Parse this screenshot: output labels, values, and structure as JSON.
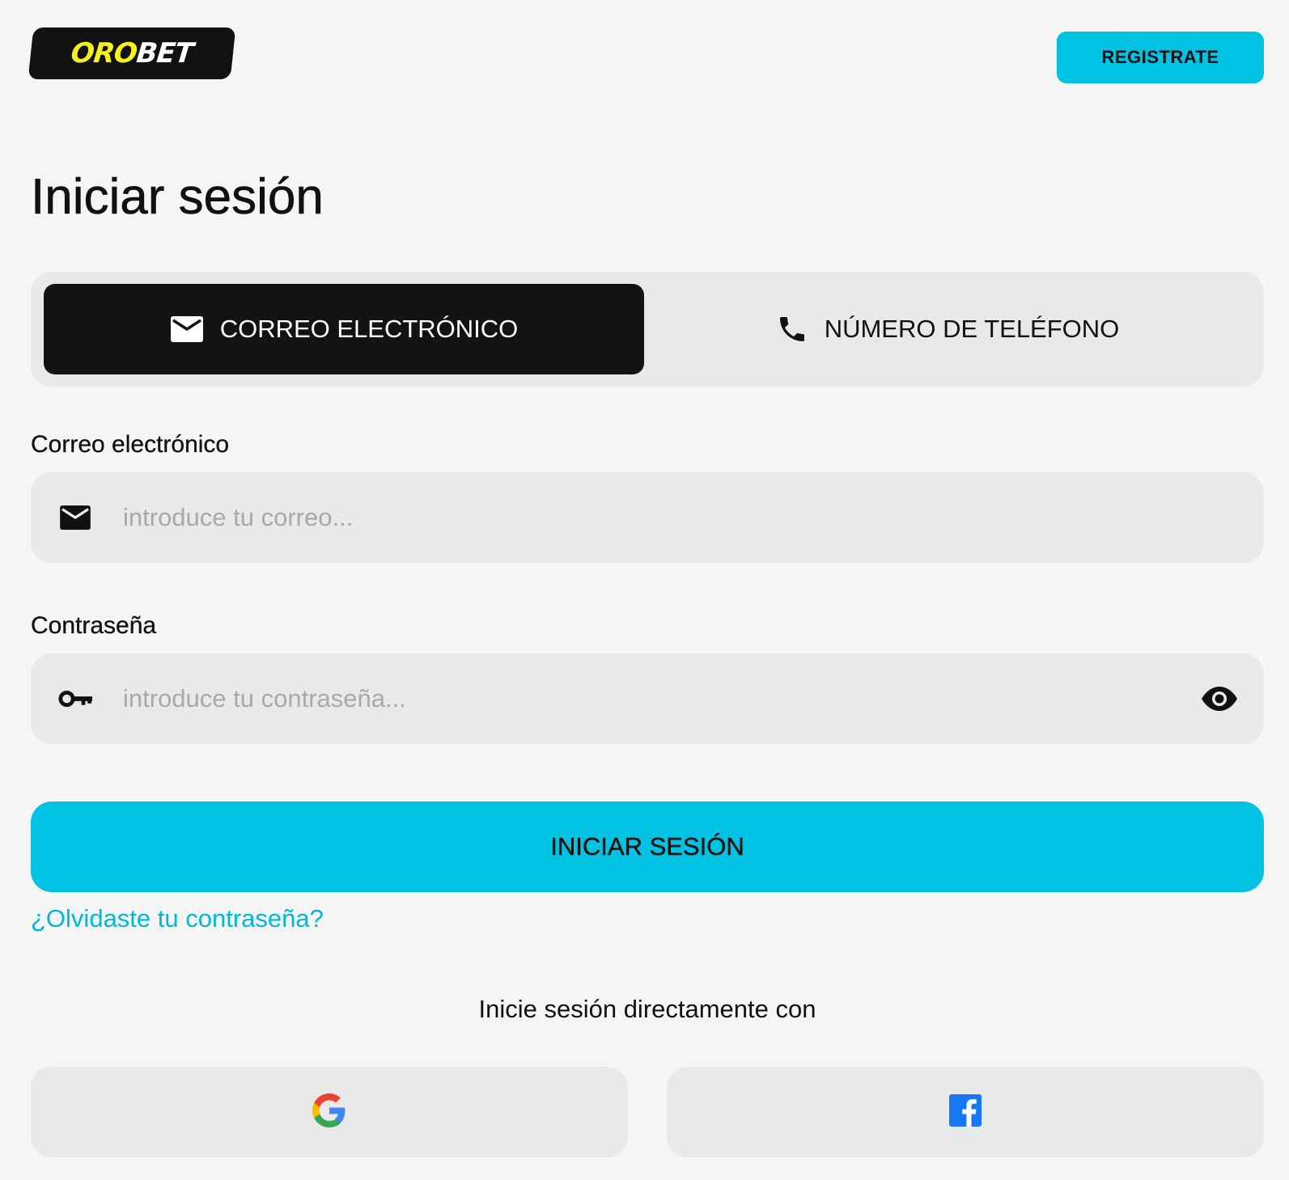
{
  "brand": {
    "logo_part1": "ORO",
    "logo_part2": "BET",
    "accent_color": "#00c3e3",
    "logo_yellow": "#f5f21a"
  },
  "header": {
    "register_label": "REGISTRATE"
  },
  "page": {
    "title": "Iniciar sesión"
  },
  "tabs": [
    {
      "label": "CORREO ELECTRÓNICO",
      "icon": "mail-icon",
      "active": true
    },
    {
      "label": "NÚMERO DE TELÉFONO",
      "icon": "phone-icon",
      "active": false
    }
  ],
  "form": {
    "email": {
      "label": "Correo electrónico",
      "placeholder": "introduce tu correo...",
      "value": "",
      "icon": "mail-icon"
    },
    "password": {
      "label": "Contraseña",
      "placeholder": "introduce tu contraseña...",
      "value": "",
      "icon": "key-icon",
      "toggle_icon": "eye-icon"
    },
    "submit_label": "INICIAR SESIÓN",
    "forgot_label": "¿Olvidaste tu contraseña?"
  },
  "social": {
    "caption": "Inicie sesión directamente con",
    "providers": [
      {
        "icon": "google-icon"
      },
      {
        "icon": "facebook-icon"
      }
    ]
  }
}
